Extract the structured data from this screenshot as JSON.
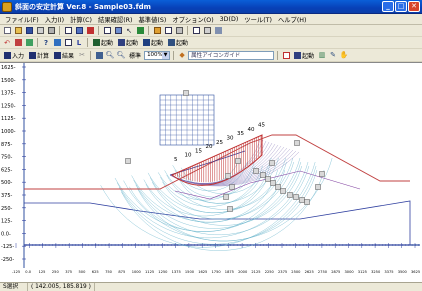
{
  "window": {
    "title": "斜面の安定計算 Ver.8 - Sample03.fdm",
    "minimize": "_",
    "maximize": "□",
    "close": "✕"
  },
  "menu": [
    "ファイル(F)",
    "入力(I)",
    "計算(C)",
    "結果確認(R)",
    "基準値(S)",
    "オプション(O)",
    "3D(D)",
    "ツール(T)",
    "ヘルプ(H)"
  ],
  "toolbar3": {
    "input_label": "入力",
    "calc_label": "計算",
    "result_label": "結果",
    "zoom_label": "標準",
    "zoom_value": "100%",
    "layer_label": "属性アイコンガイド",
    "btn_a": "起動",
    "btn_b": "起動",
    "btn_c": "起動"
  },
  "toolbar2": {
    "btn_a": "起動",
    "btn_b": "起動",
    "btn_c": "起動"
  },
  "plot": {
    "y_ticks": [
      "1625-",
      "1500-",
      "1375-",
      "1250-",
      "1125-",
      "1000-",
      "875-",
      "750-",
      "625-",
      "500-",
      "375-",
      "250-",
      "125-",
      "0.0-",
      "-125-",
      "-250-"
    ],
    "x_ticks": [
      "-125",
      "0.0",
      "125",
      "250",
      "375",
      "500",
      "625",
      "750",
      "875",
      "1000",
      "1125",
      "1250",
      "1375",
      "1500",
      "1625",
      "1750",
      "1875",
      "2000",
      "2125",
      "2250",
      "2375",
      "2500",
      "2625",
      "2750",
      "2875",
      "3000",
      "3125",
      "3250",
      "3375",
      "3500",
      "3625"
    ],
    "slice_labels": [
      "5",
      "10",
      "15",
      "20",
      "25",
      "30",
      "35",
      "40",
      "45"
    ],
    "colors": {
      "slope": "#c04040",
      "ground": "#3040a0",
      "slices": "#c03030",
      "circles": "#60b0c8",
      "grid": "#3050a0",
      "marker": "#505050"
    }
  },
  "status": {
    "mode": "S選択",
    "coords": "( 142.005, 185.819 )"
  }
}
